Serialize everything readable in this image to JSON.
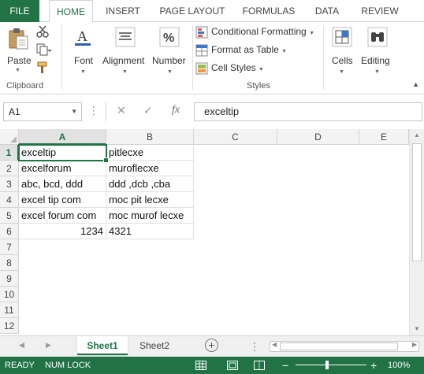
{
  "ribbon_tabs": [
    "FILE",
    "HOME",
    "INSERT",
    "PAGE LAYOUT",
    "FORMULAS",
    "DATA",
    "REVIEW"
  ],
  "ribbon": {
    "paste": "Paste",
    "clipboard": "Clipboard",
    "font": "Font",
    "alignment": "Alignment",
    "number": "Number",
    "conditional_formatting": "Conditional Formatting",
    "format_as_table": "Format as Table",
    "cell_styles": "Cell Styles",
    "styles": "Styles",
    "cells": "Cells",
    "editing": "Editing"
  },
  "formula_bar": {
    "name_box": "A1",
    "fx": "fx",
    "value": "exceltip"
  },
  "columns": [
    "A",
    "B",
    "C",
    "D",
    "E"
  ],
  "rows": [
    "1",
    "2",
    "3",
    "4",
    "5",
    "6",
    "7",
    "8",
    "9",
    "10",
    "11",
    "12"
  ],
  "cells": {
    "A1": "exceltip",
    "B1": "pitlecxe",
    "A2": "excelforum",
    "B2": "muroflecxe",
    "A3": "abc, bcd, ddd",
    "B3": "ddd ,dcb ,cba",
    "A4": "excel tip com",
    "B4": "moc pit lecxe",
    "A5": "excel forum com",
    "B5": "moc murof lecxe",
    "A6": "1234",
    "B6": "4321"
  },
  "sheets": [
    "Sheet1",
    "Sheet2"
  ],
  "status": {
    "mode": "READY",
    "num_lock": "NUM LOCK",
    "zoom": "100%"
  },
  "colors": {
    "accent": "#217346"
  }
}
